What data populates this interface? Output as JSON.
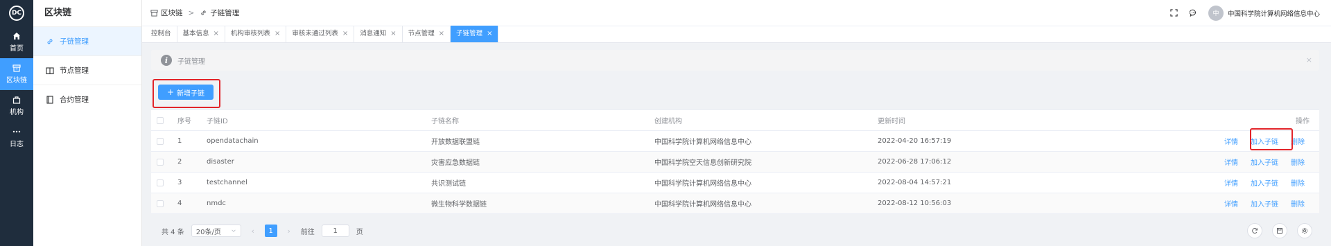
{
  "rail": {
    "logo": "DC",
    "items": [
      {
        "label": "首页",
        "icon": "home-icon"
      },
      {
        "label": "区块链",
        "icon": "blockchain-icon"
      },
      {
        "label": "机构",
        "icon": "institution-icon"
      },
      {
        "label": "日志",
        "icon": "more-icon"
      }
    ]
  },
  "subnav": {
    "title": "区块链",
    "items": [
      {
        "label": "子链管理",
        "icon": "link-icon"
      },
      {
        "label": "节点管理",
        "icon": "book-icon"
      },
      {
        "label": "合约管理",
        "icon": "contract-icon"
      }
    ]
  },
  "header": {
    "breadcrumb": [
      "区块链",
      "子链管理"
    ],
    "user_avatar": "中",
    "user_name": "中国科学院计算机网络信息中心"
  },
  "tabs": [
    {
      "label": "控制台"
    },
    {
      "label": "基本信息",
      "x": "×"
    },
    {
      "label": "机构审核列表",
      "x": "×"
    },
    {
      "label": "审核未通过列表",
      "x": "×"
    },
    {
      "label": "消息通知",
      "x": "×"
    },
    {
      "label": "节点管理",
      "x": "×"
    },
    {
      "label": "子链管理",
      "x": "×"
    }
  ],
  "alert": {
    "title": "子链管理",
    "icon": "i",
    "close": "×"
  },
  "toolbar": {
    "add_plus": "+",
    "add_label": "新增子链"
  },
  "table": {
    "headers": {
      "index": "序号",
      "id": "子链ID",
      "name": "子链名称",
      "org": "创建机构",
      "time": "更新时间",
      "ops": "操作"
    },
    "rows": [
      {
        "index": "1",
        "id": "opendatachain",
        "name": "开放数据联盟链",
        "org": "中国科学院计算机网络信息中心",
        "time": "2022-04-20 16:57:19"
      },
      {
        "index": "2",
        "id": "disaster",
        "name": "灾害应急数据链",
        "org": "中国科学院空天信息创新研究院",
        "time": "2022-06-28 17:06:12"
      },
      {
        "index": "3",
        "id": "testchannel",
        "name": "共识测试链",
        "org": "中国科学院计算机网络信息中心",
        "time": "2022-08-04 14:57:21"
      },
      {
        "index": "4",
        "id": "nmdc",
        "name": "微生物科学数据链",
        "org": "中国科学院计算机网络信息中心",
        "time": "2022-08-12 10:56:03"
      }
    ],
    "ops": {
      "detail": "详情",
      "join": "加入子链",
      "delete": "删除"
    }
  },
  "pager": {
    "total": "共 4 条",
    "page_size": "20条/页",
    "prev": "‹",
    "current": "1",
    "next": "›",
    "goto_label": "前往",
    "goto_value": "1",
    "page_suffix": "页"
  },
  "colors": {
    "primary": "#409eff",
    "rail_bg": "#1f2d3d",
    "highlight": "#e2242a"
  }
}
